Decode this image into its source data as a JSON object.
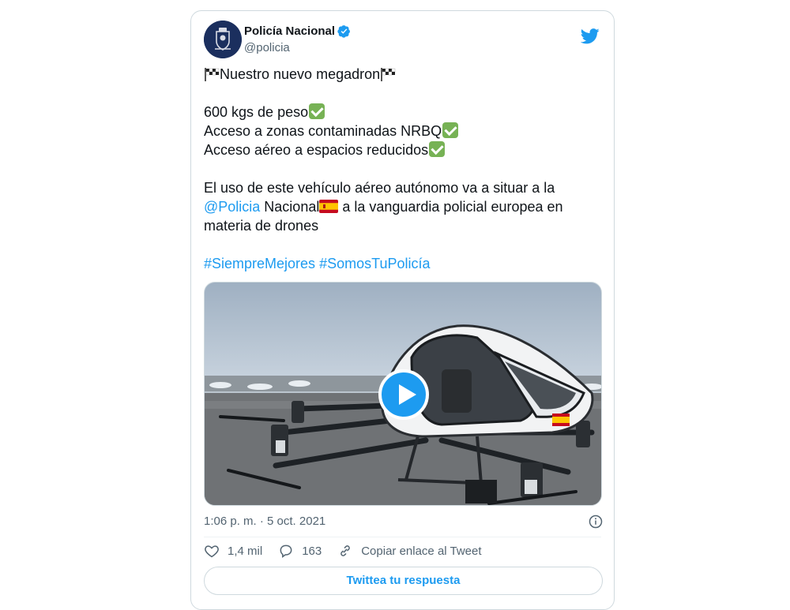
{
  "author": {
    "name": "Policía Nacional",
    "handle": "@policia"
  },
  "tweet": {
    "line1": "Nuestro nuevo megadron",
    "line2": "600 kgs de peso",
    "line3": "Acceso a zonas contaminadas NRBQ",
    "line4": "Acceso aéreo a espacios reducidos",
    "para_a": "El uso de este vehículo aéreo autónomo va a situar a la",
    "mention": "@Policia",
    "para_b": " Nacional",
    "para_c": " a la vanguardia policial europea en",
    "para_d": "materia de drones",
    "hashtag1": "#SiempreMejores",
    "hashtag2": "#SomosTuPolicía"
  },
  "meta": {
    "timestamp": "1:06 p. m. · 5 oct. 2021"
  },
  "actions": {
    "likes": "1,4 mil",
    "replies": "163",
    "copy_link": "Copiar enlace al Tweet",
    "reply_button": "Twittea tu respuesta"
  },
  "icons": {
    "brand": "twitter-bird-icon",
    "verified": "verified-badge-icon",
    "play": "play-icon",
    "info": "info-icon",
    "like": "heart-icon",
    "reply": "reply-bubble-icon",
    "link": "link-icon"
  },
  "colors": {
    "accent": "#1d9bf0",
    "text": "#0f1419",
    "muted": "#536471",
    "border": "#cfd9de"
  }
}
